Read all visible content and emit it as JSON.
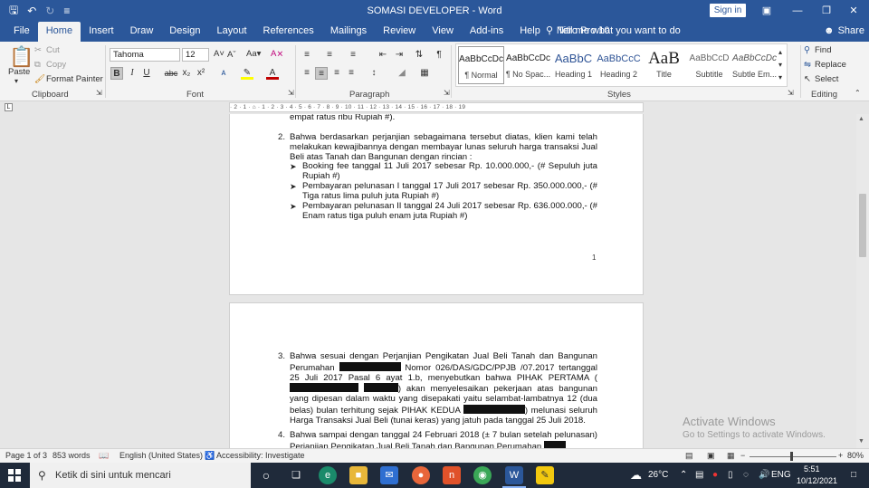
{
  "window": {
    "title": "SOMASI DEVELOPER  -  Word",
    "sign_in": "Sign in"
  },
  "menu": {
    "tabs": [
      "File",
      "Home",
      "Insert",
      "Draw",
      "Design",
      "Layout",
      "References",
      "Mailings",
      "Review",
      "View",
      "Add-ins",
      "Help",
      "Nitro Pro 10"
    ],
    "tell_me": "Tell me what you want to do",
    "share": "Share"
  },
  "ribbon": {
    "clipboard": {
      "paste": "Paste",
      "cut": "Cut",
      "copy": "Copy",
      "format_painter": "Format Painter",
      "label": "Clipboard"
    },
    "font": {
      "name": "Tahoma",
      "size": "12",
      "label": "Font"
    },
    "paragraph": {
      "label": "Paragraph"
    },
    "styles": {
      "label": "Styles",
      "items": [
        {
          "preview": "AaBbCcDc",
          "name": "¶ Normal"
        },
        {
          "preview": "AaBbCcDc",
          "name": "¶ No Spac..."
        },
        {
          "preview": "AaBbC",
          "name": "Heading 1"
        },
        {
          "preview": "AaBbCcC",
          "name": "Heading 2"
        },
        {
          "preview": "AaB",
          "name": "Title"
        },
        {
          "preview": "AaBbCcD",
          "name": "Subtitle"
        },
        {
          "preview": "AaBbCcDc",
          "name": "Subtle Em..."
        }
      ]
    },
    "editing": {
      "find": "Find",
      "replace": "Replace",
      "select": "Select",
      "label": "Editing"
    }
  },
  "ruler": {
    "marks": "· 2 · 1 · ⌂ · 1 · 2 · 3 · 4 · 5 · 6 · 7 · 8 · 9 · 10 · 11 · 12 · 13 · 14 · 15 · 16 · 17 · 18 · 19"
  },
  "document": {
    "page1": {
      "top_fragment": "empat ratus ribu Rupiah #).",
      "para2_num": "2.",
      "para2": "Bahwa berdasarkan perjanjian sebagaimana tersebut diatas, klien kami telah melakukan kewajibannya dengan membayar lunas seluruh harga transaksi Jual Beli atas Tanah dan Bangunan dengan rincian :",
      "bullets": [
        "Booking fee tanggal 11 Juli 2017 sebesar Rp. 10.000.000,- (# Sepuluh juta Rupiah #)",
        "Pembayaran pelunasan I tanggal 17 Juli 2017 sebesar Rp. 350.000.000,- (# Tiga ratus lima puluh juta Rupiah #)",
        "Pembayaran pelunasan II tanggal 24 Juli 2017 sebesar Rp. 636.000.000,- (# Enam ratus tiga puluh enam juta Rupiah #)"
      ],
      "page_number": "1"
    },
    "page2": {
      "para3_num": "3.",
      "para3_a": "Bahwa sesuai dengan Perjanjian Pengikatan Jual Beli Tanah dan Bangunan Perumahan",
      "para3_b": "Nomor 026/DAS/GDC/PPJB /07.2017 tertanggal 25 Juli 2017 Pasal 6 ayat 1.b, menyebutkan bahwa PIHAK PERTAMA (",
      "para3_c": ") akan menyelesaikan pekerjaan atas bangunan yang dipesan dalam waktu yang disepakati yaitu selambat-lambatnya 12 (dua belas) bulan terhitung sejak PIHAK KEDUA",
      "para3_d": ") melunasi seluruh Harga Transaksi Jual Beli (tunai keras) yang jatuh pada tanggal 25 Juli 2018.",
      "para4_num": "4.",
      "para4": "Bahwa sampai dengan tanggal 24 Februari 2018 (± 7 bulan setelah pelunasan) Perjanjian Pengikatan Jual Beli Tanah dan Bangunan Perumahan"
    },
    "watermark": {
      "title": "Activate Windows",
      "subtitle": "Go to Settings to activate Windows."
    }
  },
  "status": {
    "page": "Page 1 of 3",
    "words": "853 words",
    "language": "English (United States)",
    "accessibility": "Accessibility: Investigate",
    "zoom": "80%"
  },
  "taskbar": {
    "search_placeholder": "Ketik di sini untuk mencari",
    "weather": "26°C",
    "lang": "ENG",
    "time": "5:51",
    "date": "10/12/2021"
  },
  "colors": {
    "word_blue": "#2b579a",
    "taskbar": "#1f2a3a"
  }
}
